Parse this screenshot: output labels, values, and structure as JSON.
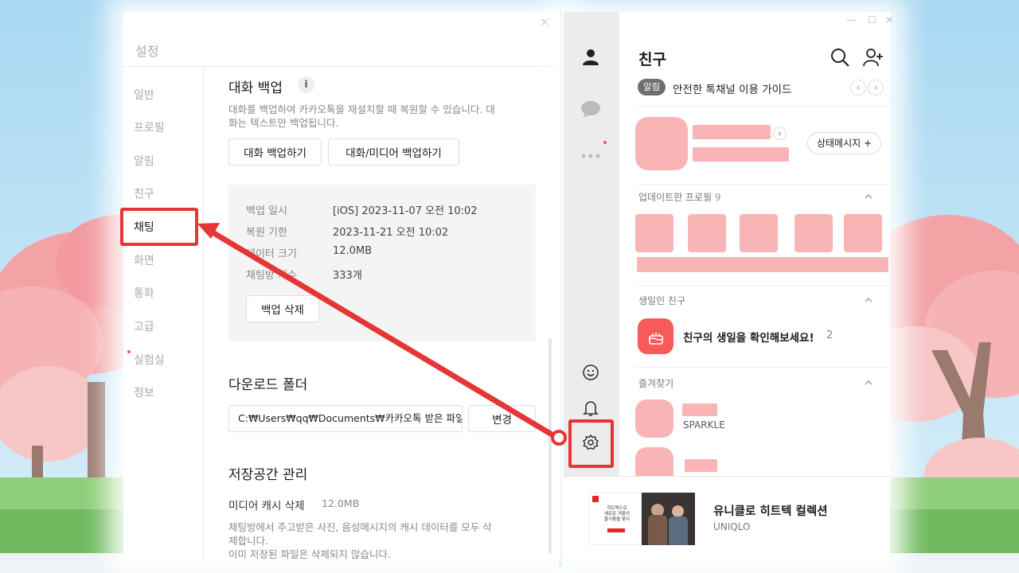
{
  "settings": {
    "title": "설정",
    "nav": [
      "일반",
      "프로필",
      "알림",
      "친구",
      "채팅",
      "화면",
      "통화",
      "고급",
      "실험실",
      "정보"
    ],
    "active_nav": "채팅",
    "backup": {
      "title": "대화 백업",
      "desc_line1": "대화를 백업하여 카카오톡을 재설치할 때 복원할 수 있습니다. 대",
      "desc_line2": "화는 텍스트만 백업됩니다.",
      "btn_backup": "대화 백업하기",
      "btn_media_backup": "대화/미디어 백업하기",
      "info": [
        {
          "label": "백업 일시",
          "value": "[iOS] 2023-11-07 오전 10:02"
        },
        {
          "label": "복원 기한",
          "value": "2023-11-21 오전 10:02"
        },
        {
          "label": "데이터 크기",
          "value": "12.0MB"
        },
        {
          "label": "채팅방 개수",
          "value": "333개"
        }
      ],
      "btn_delete": "백업 삭제"
    },
    "download": {
      "title": "다운로드 폴더",
      "path": "C:₩Users₩qq₩Documents₩카카오톡 받은 파일",
      "btn_change": "변경"
    },
    "storage": {
      "title": "저장공간 관리",
      "cache_label": "미디어 캐시 삭제",
      "cache_size": "12.0MB",
      "desc_line1": "채팅방에서 주고받은 사진, 음성메시지의 캐시 데이터를 모두 삭",
      "desc_line2": "제합니다.",
      "desc_line3": "이미 저장된 파일은 삭제되지 않습니다."
    }
  },
  "friends": {
    "title": "친구",
    "notice_pill": "알림",
    "notice_text": "안전한 톡채널 이용 가이드",
    "status_btn": "상태메시지 +",
    "updated_profiles_label": "업데이트한 프로필",
    "updated_profiles_count": "9",
    "birthday_label": "생일인 친구",
    "birthday_text": "친구의 생일을 확인해보세요!",
    "birthday_count": "2",
    "favorites_label": "즐겨찾기",
    "favorite_name": "SPARKLE",
    "ad_title": "유니클로 히트텍 컬렉션",
    "ad_brand": "UNIQLO",
    "ad_thumb_text_1": "히트텍으로",
    "ad_thumb_text_2": "새로운 겨울의",
    "ad_thumb_text_3": "즐거움을 맞다"
  },
  "colors": {
    "highlight_red": "#e53535",
    "accent_pink": "#f9b5b5",
    "birthday_red": "#f65a5a"
  },
  "icons": [
    "close-icon",
    "person-icon",
    "chat-bubble-icon",
    "more-dots-icon",
    "emoji-icon",
    "bell-icon",
    "gear-icon",
    "search-icon",
    "add-friend-icon",
    "chevron-left-icon",
    "chevron-right-icon",
    "chevron-up-icon",
    "info-icon",
    "cake-icon",
    "arrow-annotation"
  ]
}
